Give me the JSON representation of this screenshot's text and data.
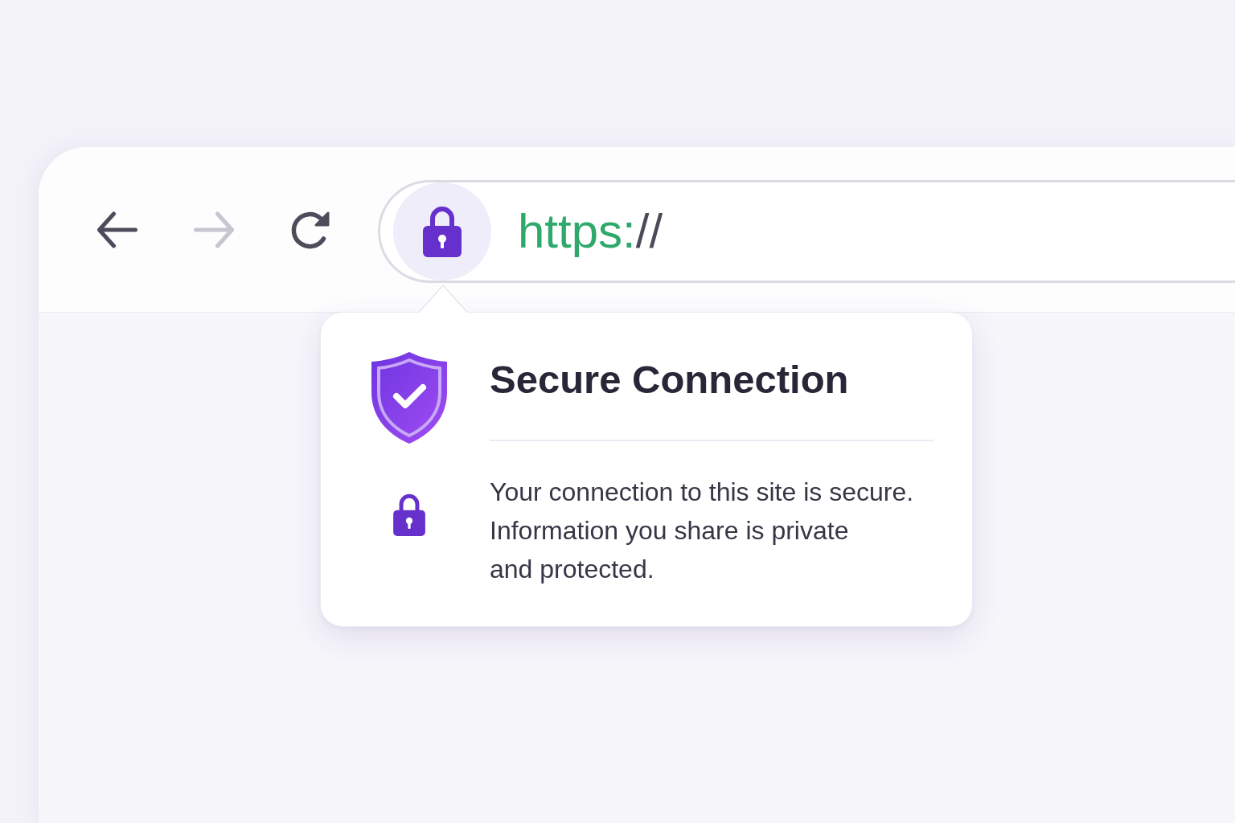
{
  "toolbar": {
    "nav_buttons": [
      {
        "kind": "back",
        "disabled": false
      },
      {
        "kind": "forward",
        "disabled": true
      },
      {
        "kind": "reload",
        "disabled": false
      }
    ],
    "address_bar": {
      "site_info_button": {
        "expanded": true
      },
      "url_parts": [
        {
          "kind": "scheme",
          "text": "https:"
        },
        {
          "kind": "rest",
          "text": "//"
        }
      ]
    }
  },
  "security_popup": {
    "title": "Secure Connection",
    "body": "Your connection to this site is secure.\nInformation you share is private\nand protected."
  }
}
